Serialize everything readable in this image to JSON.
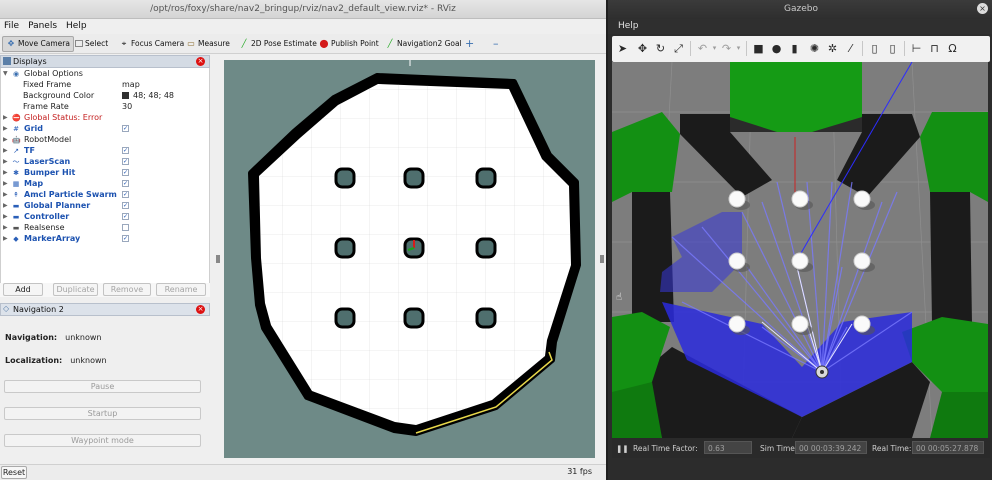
{
  "rviz": {
    "title": "/opt/ros/foxy/share/nav2_bringup/rviz/nav2_default_view.rviz* - RViz",
    "menu": [
      "File",
      "Panels",
      "Help"
    ],
    "tools": {
      "move_camera": "Move Camera",
      "select": "Select",
      "focus_camera": "Focus Camera",
      "measure": "Measure",
      "pose_estimate": "2D Pose Estimate",
      "publish_point": "Publish Point",
      "nav_goal": "Navigation2 Goal",
      "plus": "+",
      "minus": "–"
    },
    "displays": {
      "header": "Displays",
      "global_options": {
        "label": "Global Options",
        "fixed_frame_label": "Fixed Frame",
        "fixed_frame_value": "map",
        "bg_color_label": "Background Color",
        "bg_color_value": "48; 48; 48",
        "frame_rate_label": "Frame Rate",
        "frame_rate_value": "30"
      },
      "items": [
        {
          "label": "Global Status: Error",
          "style": "red",
          "icon": "error-icon",
          "glyph": "⛔",
          "checked": null
        },
        {
          "label": "Grid",
          "style": "blue",
          "icon": "grid-icon",
          "glyph": "#",
          "checked": true
        },
        {
          "label": "RobotModel",
          "style": "plain",
          "icon": "robot-model-icon",
          "glyph": "🤖",
          "checked": null
        },
        {
          "label": "TF",
          "style": "blue",
          "icon": "tf-icon",
          "glyph": "↗",
          "checked": true
        },
        {
          "label": "LaserScan",
          "style": "blue",
          "icon": "laser-scan-icon",
          "glyph": "〜",
          "checked": true
        },
        {
          "label": "Bumper Hit",
          "style": "blue",
          "icon": "bumper-icon",
          "glyph": "✱",
          "checked": true
        },
        {
          "label": "Map",
          "style": "blue",
          "icon": "map-icon",
          "glyph": "▦",
          "checked": true
        },
        {
          "label": "Amcl Particle Swarm",
          "style": "blue",
          "icon": "particle-swarm-icon",
          "glyph": "↟",
          "checked": true
        },
        {
          "label": "Global Planner",
          "style": "blue",
          "icon": "folder-icon",
          "glyph": "▬",
          "checked": true
        },
        {
          "label": "Controller",
          "style": "blue",
          "icon": "folder-icon",
          "glyph": "▬",
          "checked": true
        },
        {
          "label": "Realsense",
          "style": "plain",
          "icon": "folder-icon",
          "glyph": "▬",
          "checked": false
        },
        {
          "label": "MarkerArray",
          "style": "blue",
          "icon": "marker-array-icon",
          "glyph": "◆",
          "checked": true
        }
      ],
      "buttons": {
        "add": "Add",
        "duplicate": "Duplicate",
        "remove": "Remove",
        "rename": "Rename"
      }
    },
    "navigation": {
      "header": "Navigation 2",
      "nav_label": "Navigation:",
      "nav_value": "unknown",
      "loc_label": "Localization:",
      "loc_value": "unknown",
      "pause": "Pause",
      "startup": "Startup",
      "waypoint": "Waypoint mode"
    },
    "status": {
      "reset": "Reset",
      "fps": "31 fps"
    }
  },
  "gazebo": {
    "title": "Gazebo",
    "menu": [
      "Help"
    ],
    "status": {
      "rtf_label": "Real Time Factor:",
      "rtf_value": "0.63",
      "sim_label": "Sim Time:",
      "sim_value": "00 00:03:39.242",
      "real_label": "Real Time:",
      "real_value": "00 00:05:27.878"
    }
  },
  "colors": {
    "map_bg": "#6e8a87",
    "map_free": "#ffffff",
    "map_wall": "#000000",
    "obstacle": "#4f6f6e",
    "laser": "#2a2ad8",
    "wall_green": "#1aa31a"
  }
}
